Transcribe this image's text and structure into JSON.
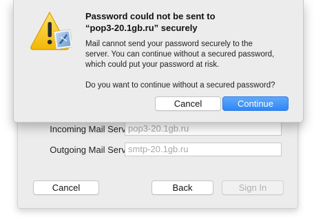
{
  "alert": {
    "title_line1": "Password could not be sent to",
    "title_line2": "“pop3-20.1gb.ru” securely",
    "body_line1": "Mail cannot send your password securely to the",
    "body_line2": "server. You can continue without a secured password,",
    "body_line3": "which could put your password at risk.",
    "question": "Do you want to continue without a secured password?",
    "cancel_label": "Cancel",
    "continue_label": "Continue",
    "icon": "warning-mail-icon"
  },
  "setup": {
    "incoming_label": "Incoming Mail Server:",
    "incoming_value": "pop3-20.1gb.ru",
    "outgoing_label": "Outgoing Mail Server:",
    "outgoing_value": "smtp-20.1gb.ru",
    "cancel_label": "Cancel",
    "back_label": "Back",
    "signin_label": "Sign In"
  },
  "colors": {
    "accent": "#2f86f5",
    "warning": "#f5c518"
  }
}
